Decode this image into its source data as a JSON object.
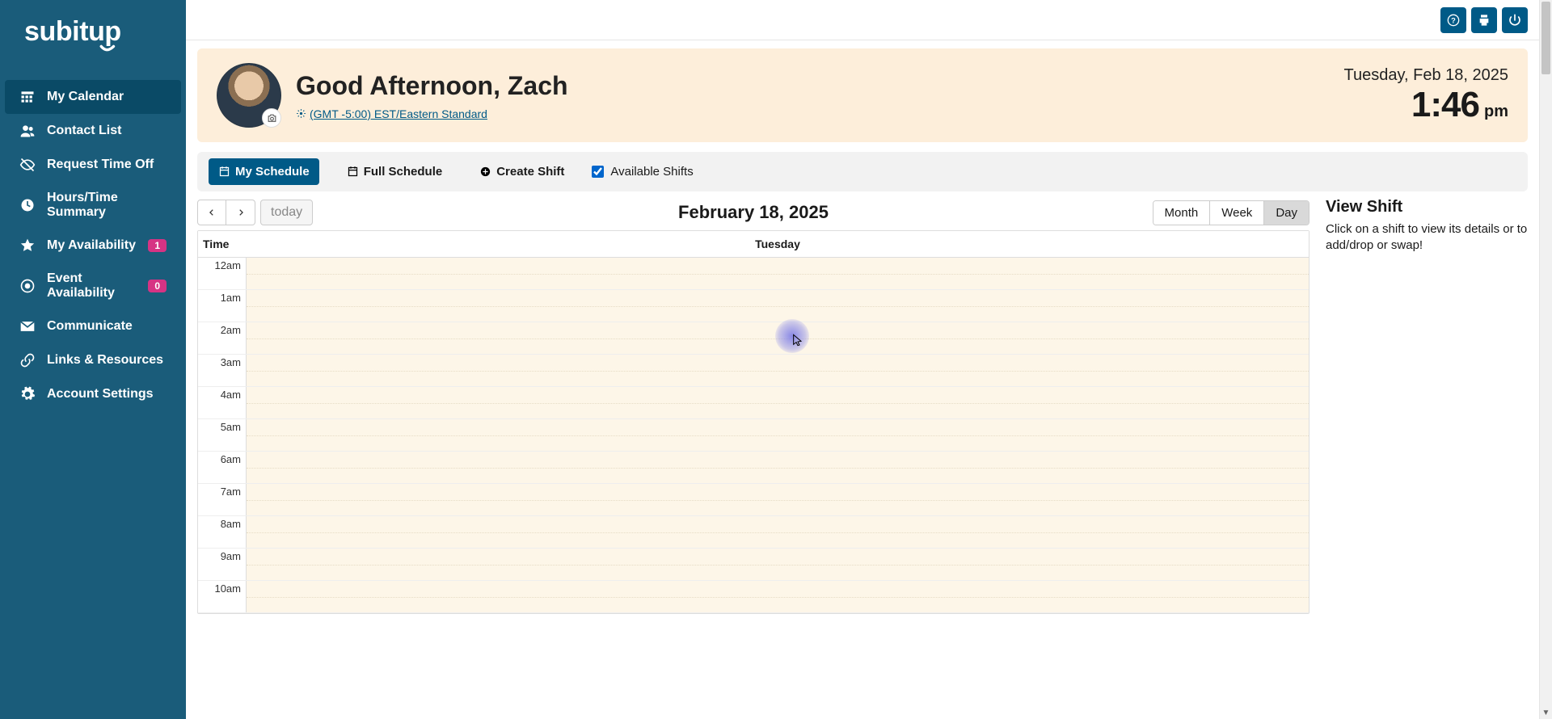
{
  "brand": "subitup",
  "sidebar": {
    "items": [
      {
        "label": "My Calendar",
        "icon": "calendar-grid-icon",
        "active": true
      },
      {
        "label": "Contact List",
        "icon": "people-icon"
      },
      {
        "label": "Request Time Off",
        "icon": "eye-off-icon"
      },
      {
        "label": "Hours/Time Summary",
        "icon": "clock-icon"
      },
      {
        "label": "My Availability",
        "icon": "star-icon",
        "badge": "1"
      },
      {
        "label": "Event Availability",
        "icon": "target-icon",
        "badge": "0"
      },
      {
        "label": "Communicate",
        "icon": "envelope-icon"
      },
      {
        "label": "Links & Resources",
        "icon": "link-icon"
      },
      {
        "label": "Account Settings",
        "icon": "gear-icon"
      }
    ]
  },
  "topbar": {
    "help": "?",
    "print": "print",
    "power": "power"
  },
  "banner": {
    "greeting": "Good Afternoon, Zach",
    "timezone": "(GMT -5:00) EST/Eastern Standard",
    "date": "Tuesday, Feb 18, 2025",
    "time": "1:46",
    "ampm": "pm"
  },
  "toolbar": {
    "my_schedule": "My Schedule",
    "full_schedule": "Full Schedule",
    "create_shift": "Create Shift",
    "available_shifts": "Available Shifts",
    "available_shifts_checked": true
  },
  "calendar": {
    "title": "February 18, 2025",
    "today_label": "today",
    "views": {
      "month": "Month",
      "week": "Week",
      "day": "Day",
      "active": "Day"
    },
    "time_header": "Time",
    "day_header": "Tuesday",
    "hours": [
      "12am",
      "1am",
      "2am",
      "3am",
      "4am",
      "5am",
      "6am",
      "7am",
      "8am",
      "9am",
      "10am"
    ]
  },
  "shift_panel": {
    "title": "View Shift",
    "body": "Click on a shift to view its details or to add/drop or swap!"
  }
}
